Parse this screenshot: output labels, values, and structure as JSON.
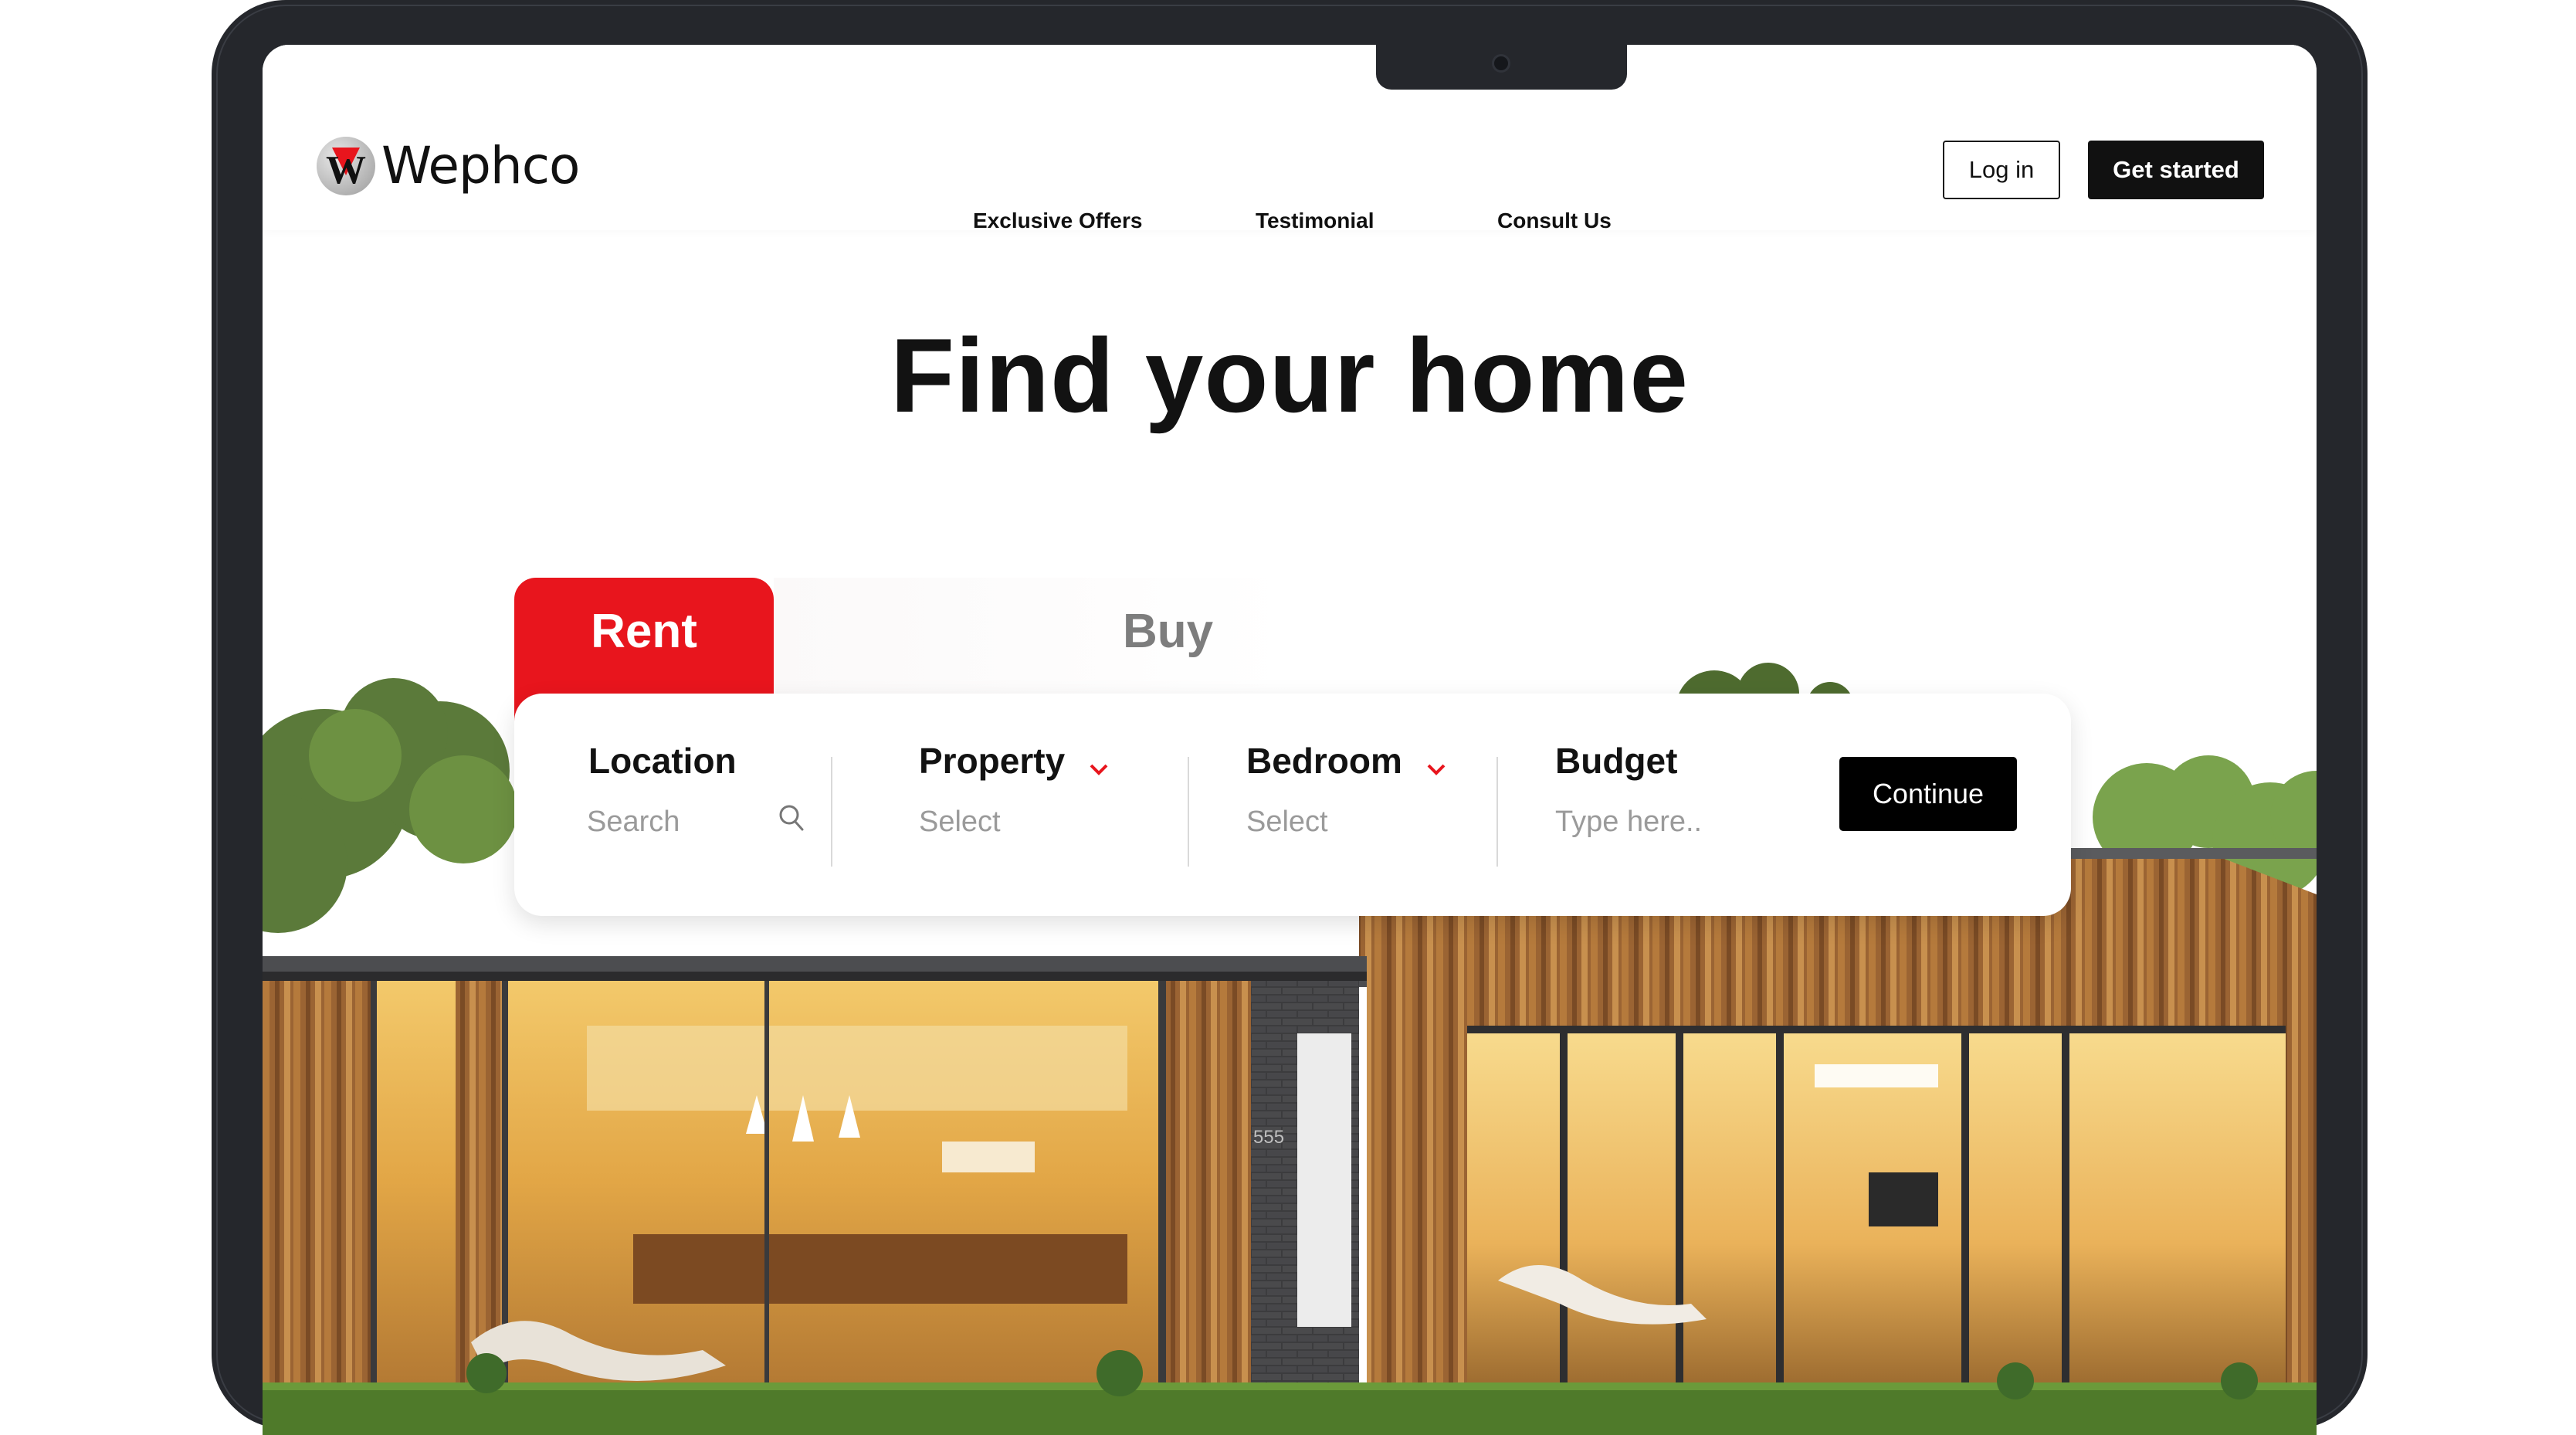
{
  "brand": {
    "name": "Wephco",
    "logo_letter": "W",
    "accent": "#e8151d"
  },
  "nav": {
    "items": [
      "Exclusive Offers",
      "Testimonial",
      "Consult Us"
    ]
  },
  "auth": {
    "login": "Log in",
    "get_started": "Get started"
  },
  "hero": {
    "title": "Find your home"
  },
  "tabs": {
    "rent": "Rent",
    "buy": "Buy",
    "active": "Rent"
  },
  "search": {
    "location": {
      "label": "Location",
      "placeholder": "Search"
    },
    "property": {
      "label": "Property",
      "placeholder": "Select"
    },
    "bedroom": {
      "label": "Bedroom",
      "placeholder": "Select"
    },
    "budget": {
      "label": "Budget",
      "placeholder": "Type here.."
    },
    "continue": "Continue"
  },
  "house": {
    "number": "555"
  }
}
